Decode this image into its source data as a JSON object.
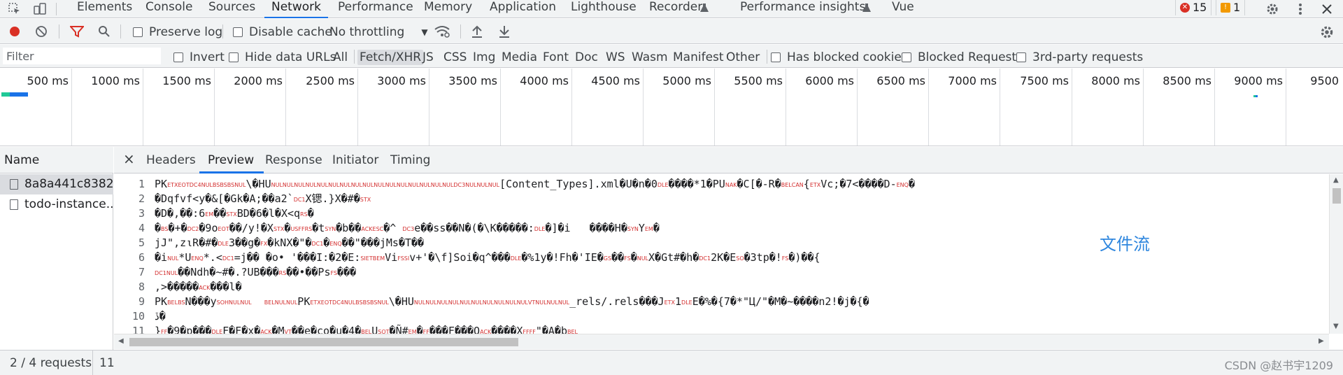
{
  "tabs": [
    {
      "label": "Elements"
    },
    {
      "label": "Console"
    },
    {
      "label": "Sources"
    },
    {
      "label": "Network"
    },
    {
      "label": "Performance"
    },
    {
      "label": "Memory"
    },
    {
      "label": "Application"
    },
    {
      "label": "Lighthouse"
    },
    {
      "label": "Recorder"
    },
    {
      "label": "Performance insights"
    },
    {
      "label": "Vue"
    }
  ],
  "badges": {
    "errors": "15",
    "warnings": "1"
  },
  "toolbar": {
    "preserve_log": "Preserve log",
    "disable_cache": "Disable cache",
    "throttling": "No throttling"
  },
  "filter": {
    "placeholder": "Filter",
    "invert": "Invert",
    "hide_data_urls": "Hide data URLs",
    "types": [
      "All",
      "Fetch/XHR",
      "JS",
      "CSS",
      "Img",
      "Media",
      "Font",
      "Doc",
      "WS",
      "Wasm",
      "Manifest",
      "Other"
    ],
    "has_blocked_cookies": "Has blocked cookies",
    "blocked_requests": "Blocked Requests",
    "third_party": "3rd-party requests"
  },
  "timeline": {
    "ticks": [
      "500 ms",
      "1000 ms",
      "1500 ms",
      "2000 ms",
      "2500 ms",
      "3000 ms",
      "3500 ms",
      "4000 ms",
      "4500 ms",
      "5000 ms",
      "5500 ms",
      "6000 ms",
      "6500 ms",
      "7000 ms",
      "7500 ms",
      "8000 ms",
      "8500 ms",
      "9000 ms",
      "9500"
    ]
  },
  "requests": {
    "header": "Name",
    "items": [
      {
        "name": "8a8a441c8382..."
      },
      {
        "name": "todo-instance..."
      }
    ]
  },
  "detail": {
    "tabs": [
      "Headers",
      "Preview",
      "Response",
      "Initiator",
      "Timing"
    ]
  },
  "preview_lines": [
    {
      "n": "1",
      "t": "PK[ETX][EOT][DC4][NUL][BS][BS][BS][NUL]\\�HU[NUL][NUL][NUL][NUL][NUL][NUL][NUL][NUL][NUL][NUL][NUL][NUL][NUL][NUL][NUL][NUL][DC3][NUL][NUL][NUL][Content_Types].xml�U�n�0[DLE]����*1�PU[NAK]�C[�-R�[BEL][CAN]{[ETX]Vc;�7<����D-[ENQ]�"
    },
    {
      "n": "2",
      "t": "�Dqfvf<y�&[�Gk�A;��a2`[DC1]X锶.}X�#�[STX]"
    },
    {
      "n": "3",
      "t": "�D�,��:6[EM]��[STX]BD�6�l�X<q[RS]�"
    },
    {
      "n": "4",
      "t": "�[BS]�+�[DC2]�9o[EOT]��/y!�X[STX]�[US][FF][RS]�t[SYN]�b��[ACK][ESC]�^ [DC3]e��ss��N�(�\\K�����:[DLE]�]�i   ����H�[SYN]Y[EM]�"
    },
    {
      "n": "5",
      "t": "jJ\",z⍳R�#�[DLE]3��g�[FX]�kNX�\"�[DC1]�[ENQ]��\"���jMs�T��"
    },
    {
      "n": "6",
      "t": "�i[NUL]*U[ENQ]*.<[DC1]=j�� �o• '���I:�2�E:[SI][ETB][EM]Vi[FS][SI]v+'�\\f]Soi�q^���[DLE]�%1y�!Fh�'IE�[GS]��[FS]�[NUL]X�Gt#�h�[DC1]2K�E[SO]�3tp�![FS]�)��{"
    },
    {
      "n": "7",
      "t": "[DC1][NUL]��Ndh�~#�.?UB���[RS]��•��Ps[FS]���"
    },
    {
      "n": "8",
      "t": ",>�����[ACK]���l�"
    },
    {
      "n": "9",
      "t": "PK[BEL][BS]N���y[SOH][NUL][NUL]  [BEL][NUL][NUL]PK[ETX][EOT][DC4][NUL][BS][BS][BS][NUL]\\�HU[NUL][NUL][NUL][NUL][NUL][NUL][NUL][NUL][NUL][NUL][VT][NUL][NUL][NUL]_rels/.rels���J[ETX]1[DLE]E�%�{7�*\"Ц/\"�M�~����n2!�j�{�"
    },
    {
      "n": "10",
      "t": "ڏ�"
    },
    {
      "n": "11",
      "t": "}[FF]�9�p���[DLE]F�F�x�[ACK]�M[VT]��e�co�u�4�[BEL]U[SOT]�Ñ#[EM]�[FF]���F���Q[ACK]����X[FF][FF]\"�A�b[BEL]"
    }
  ],
  "annotation": "文件流",
  "status": {
    "requests": "2 / 4 requests",
    "transferred": "11"
  },
  "watermark": "CSDN @赵书宇1209",
  "colors": {
    "accent": "#1a73e8",
    "control_char": "#d32f2f",
    "annotation": "#2e86de"
  }
}
